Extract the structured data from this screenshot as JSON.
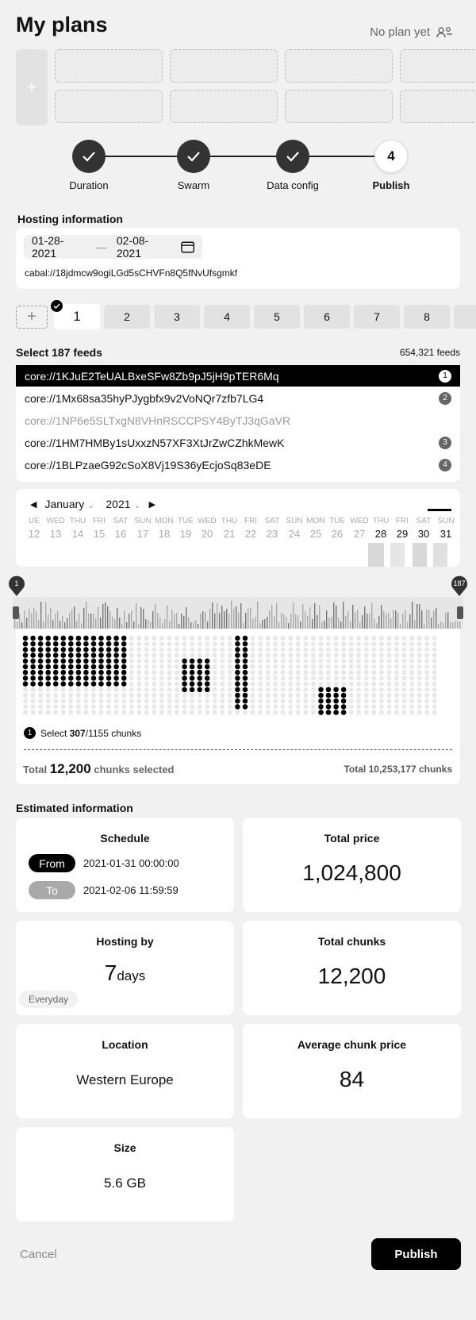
{
  "header": {
    "title": "My plans",
    "no_plan": "No plan yet"
  },
  "add_plan_label": "+",
  "steps": [
    {
      "label": "Duration",
      "done": true
    },
    {
      "label": "Swarm",
      "done": true
    },
    {
      "label": "Data config",
      "done": true
    },
    {
      "label": "Publish",
      "number": "4",
      "done": false
    }
  ],
  "hosting": {
    "title": "Hosting information",
    "start_date": "01-28-2021",
    "dash": "—",
    "end_date": "02-08-2021",
    "address": "cabal://18jdmcw9ogiLGd5sCHVFn8Q5fNvUfsgmkf"
  },
  "pages": {
    "add_label": "+",
    "items": [
      "1",
      "2",
      "3",
      "4",
      "5",
      "6",
      "7",
      "8"
    ]
  },
  "feeds": {
    "title": "Select 187 feeds",
    "count": "654,321 feeds",
    "items": [
      {
        "address": "core://1KJuE2TeUALBxeSFw8Zb9pJ5jH9pTER6Mq",
        "badge": "1",
        "state": "selected"
      },
      {
        "address": "core://1Mx68sa35hyPJygbfx9v2VoNQr7zfb7LG4",
        "badge": "2",
        "state": "normal"
      },
      {
        "address": "core://1NP6e5SLTxgN8VHnRSCCPSY4ByTJ3qGaVR",
        "badge": "",
        "state": "dim"
      },
      {
        "address": "core://1HM7HMBy1sUxxzN57XF3XtJrZwCZhkMewK",
        "badge": "3",
        "state": "normal"
      },
      {
        "address": "core://1BLPzaeG92cSoX8Vj19S36yEcjoSq83eDE",
        "badge": "4",
        "state": "normal"
      }
    ]
  },
  "calendar": {
    "month": "January",
    "year": "2021",
    "days": [
      {
        "dow": "UE",
        "num": "12"
      },
      {
        "dow": "WED",
        "num": "13"
      },
      {
        "dow": "THU",
        "num": "14"
      },
      {
        "dow": "FRI",
        "num": "15"
      },
      {
        "dow": "SAT",
        "num": "16"
      },
      {
        "dow": "SUN",
        "num": "17"
      },
      {
        "dow": "MON",
        "num": "18"
      },
      {
        "dow": "TUE",
        "num": "19"
      },
      {
        "dow": "WED",
        "num": "20"
      },
      {
        "dow": "THU",
        "num": "21"
      },
      {
        "dow": "FRI",
        "num": "22"
      },
      {
        "dow": "SAT",
        "num": "23"
      },
      {
        "dow": "SUN",
        "num": "24"
      },
      {
        "dow": "MON",
        "num": "25"
      },
      {
        "dow": "TUE",
        "num": "26"
      },
      {
        "dow": "WED",
        "num": "27"
      },
      {
        "dow": "THU",
        "num": "28"
      },
      {
        "dow": "FRI",
        "num": "29"
      },
      {
        "dow": "SAT",
        "num": "30"
      },
      {
        "dow": "SUN",
        "num": "31"
      }
    ]
  },
  "range": {
    "start": "1",
    "end": "187"
  },
  "chunks": {
    "step_badge": "1",
    "select_prefix": "Select",
    "selected": "307",
    "total_suffix": "/1155 chunks",
    "total_label": "Total",
    "total_selected": "12,200",
    "selected_suffix": "chunks selected",
    "grand_total": "Total 10,253,177 chunks"
  },
  "estimated": {
    "title": "Estimated information",
    "schedule": {
      "label": "Schedule",
      "from_tag": "From",
      "from": "2021-01-31 00:00:00",
      "to_tag": "To",
      "to": "2021-02-06 11:59:59"
    },
    "total_price": {
      "label": "Total price",
      "value": "1,024,800"
    },
    "hosting_by": {
      "label": "Hosting by",
      "value": "7",
      "unit": "days",
      "tag": "Everyday"
    },
    "total_chunks": {
      "label": "Total chunks",
      "value": "12,200"
    },
    "location": {
      "label": "Location",
      "value": "Western Europe"
    },
    "avg_price": {
      "label": "Average chunk price",
      "value": "84"
    },
    "size": {
      "label": "Size",
      "value": "5.6 GB"
    }
  },
  "actions": {
    "cancel": "Cancel",
    "publish": "Publish"
  }
}
